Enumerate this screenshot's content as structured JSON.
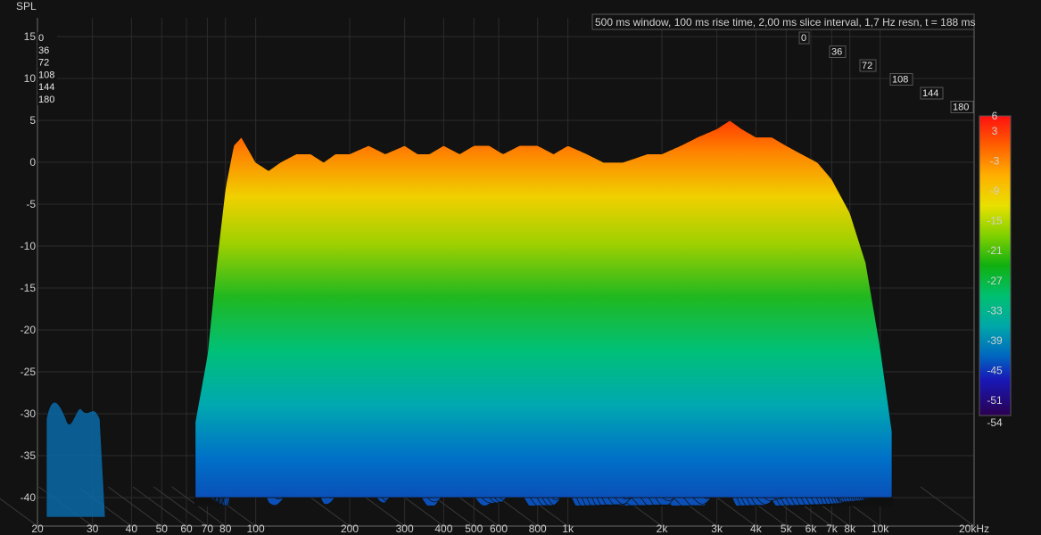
{
  "chart_data": {
    "type": "waterfall",
    "title": "500 ms window, 100 ms rise time, 2,00 ms slice interval, 1,7 Hz resn, t = 188 ms",
    "ylabel": "SPL",
    "y_ticks": [
      "15",
      "10",
      "5",
      "0",
      "-5",
      "-10",
      "-15",
      "-20",
      "-25",
      "-30",
      "-35",
      "-40"
    ],
    "x_ticks": [
      "20",
      "30",
      "40",
      "50",
      "60",
      "70",
      "80",
      "100",
      "200",
      "300",
      "400",
      "500",
      "600",
      "800",
      "1k",
      "2k",
      "3k",
      "4k",
      "5k",
      "6k",
      "7k",
      "8k",
      "10k",
      "20kHz"
    ],
    "x_tick_values": [
      20,
      30,
      40,
      50,
      60,
      70,
      80,
      100,
      200,
      300,
      400,
      500,
      600,
      800,
      1000,
      2000,
      3000,
      4000,
      5000,
      6000,
      7000,
      8000,
      10000,
      20000
    ],
    "time_ticks": [
      "0",
      "36",
      "72",
      "108",
      "144",
      "180"
    ],
    "colorbar_ticks": [
      "6",
      "3",
      "-3",
      "-9",
      "-15",
      "-21",
      "-27",
      "-33",
      "-39",
      "-45",
      "-51",
      "-54"
    ],
    "colorbar_range": [
      -54,
      6
    ],
    "ylim": [
      -42,
      16
    ],
    "xlim": [
      20,
      20000
    ],
    "time_range_ms": [
      0,
      188
    ],
    "slice_interval_ms": 2,
    "front_response": {
      "x": [
        64,
        70,
        75,
        80,
        85,
        90,
        100,
        110,
        120,
        135,
        150,
        165,
        180,
        200,
        230,
        260,
        300,
        330,
        360,
        400,
        450,
        500,
        560,
        620,
        700,
        800,
        900,
        1000,
        1150,
        1300,
        1500,
        1800,
        2000,
        2300,
        2600,
        3000,
        3300,
        3600,
        4000,
        4500,
        5000,
        5600,
        6300,
        7000,
        8000,
        9000,
        10000,
        11000
      ],
      "y": [
        -31,
        -23,
        -12,
        -3,
        2,
        3,
        0,
        -1,
        0,
        1,
        1,
        0,
        1,
        1,
        2,
        1,
        2,
        1,
        1,
        2,
        1,
        2,
        2,
        1,
        2,
        2,
        1,
        2,
        1,
        0,
        0,
        1,
        1,
        2,
        3,
        4,
        5,
        4,
        3,
        3,
        2,
        1,
        0,
        -2,
        -6,
        -12,
        -22,
        -33
      ]
    },
    "colors": {
      "background": "#121212",
      "grid": "#3a3a3a"
    }
  }
}
